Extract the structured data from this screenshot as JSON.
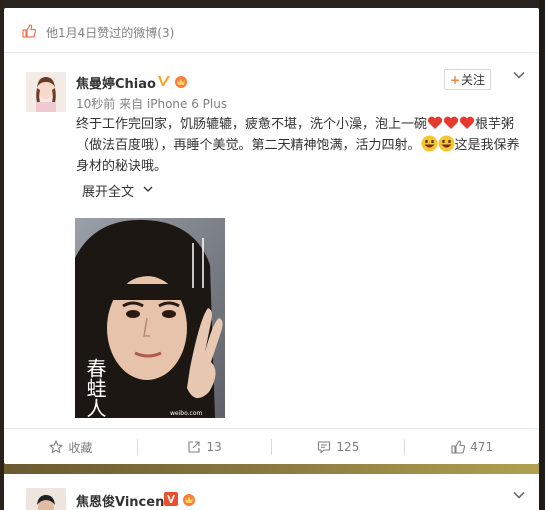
{
  "liked_bar": {
    "text": "他1月4日赞过的微博(3)"
  },
  "post": {
    "username": "焦曼婷Chiao",
    "meta": "10秒前 来自 iPhone 6 Plus",
    "follow_label": "关注",
    "text_part1": "终于工作完回家，饥肠辘辘，疲惫不堪，洗个小澡，泡上一碗",
    "text_part2": "根芋粥（做法百度哦），再睡个美觉。第二天精神饱满，活力四射。",
    "text_part3": "这是我保养身材的秘诀哦。",
    "expand_label": "展开全文",
    "photo_caption": "春蛙人"
  },
  "actions": [
    {
      "label": "收藏",
      "icon": "star-icon"
    },
    {
      "label": "13",
      "icon": "share-icon"
    },
    {
      "label": "125",
      "icon": "comment-icon"
    },
    {
      "label": "471",
      "icon": "thumbs-up-icon"
    }
  ],
  "next_post": {
    "username": "焦恩俊Vincent"
  },
  "colors": {
    "accent": "#fa7d3c",
    "like_icon": "#eb7350",
    "vip": "#f5a623",
    "muted_text": "#808080"
  }
}
